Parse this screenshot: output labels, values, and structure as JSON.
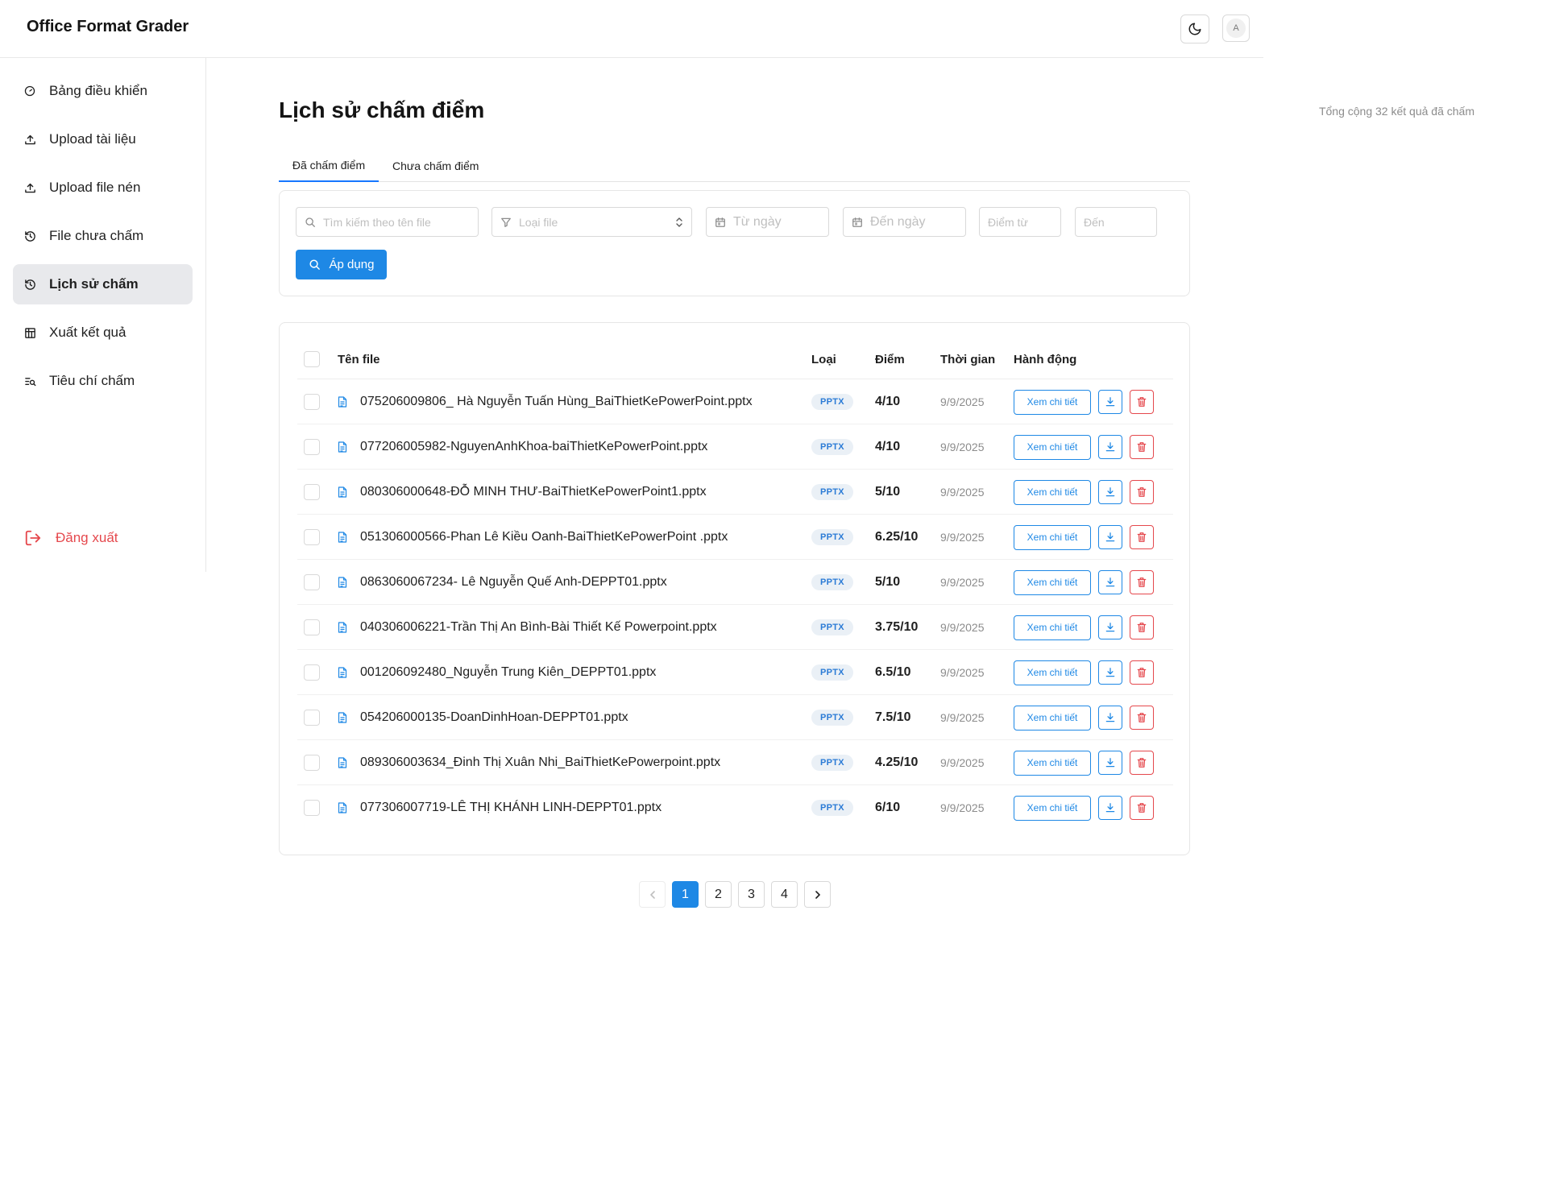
{
  "app": {
    "title": "Office Format Grader",
    "avatar_letter": "A"
  },
  "sidebar": {
    "items": [
      {
        "label": "Bảng điều khiển",
        "icon": "dashboard-icon"
      },
      {
        "label": "Upload tài liệu",
        "icon": "upload-icon"
      },
      {
        "label": "Upload file nén",
        "icon": "upload-icon"
      },
      {
        "label": "File chưa chấm",
        "icon": "history-icon"
      },
      {
        "label": "Lịch sử chấm",
        "icon": "history-icon",
        "active": true
      },
      {
        "label": "Xuất kết quả",
        "icon": "table-export-icon"
      },
      {
        "label": "Tiêu chí chấm",
        "icon": "list-search-icon"
      }
    ],
    "logout_label": "Đăng xuất"
  },
  "page": {
    "title": "Lịch sử chấm điểm",
    "total_text": "Tổng cộng 32 kết quả đã chấm",
    "tabs": [
      {
        "label": "Đã chấm điểm",
        "active": true
      },
      {
        "label": "Chưa chấm điểm",
        "active": false
      }
    ]
  },
  "filters": {
    "search_placeholder": "Tìm kiếm theo tên file",
    "filetype_placeholder": "Loại file",
    "from_date_placeholder": "Từ ngày",
    "to_date_placeholder": "Đến ngày",
    "score_from_placeholder": "Điểm từ",
    "score_to_placeholder": "Đến",
    "apply_label": "Áp dụng"
  },
  "table": {
    "headers": {
      "name": "Tên file",
      "type": "Loại",
      "score": "Điểm",
      "time": "Thời gian",
      "actions": "Hành động"
    },
    "detail_label": "Xem chi tiết",
    "rows": [
      {
        "name": "075206009806_ Hà Nguyễn Tuấn Hùng_BaiThietKePowerPoint.pptx",
        "type": "PPTX",
        "score": "4/10",
        "time": "9/9/2025"
      },
      {
        "name": "077206005982-NguyenAnhKhoa-baiThietKePowerPoint.pptx",
        "type": "PPTX",
        "score": "4/10",
        "time": "9/9/2025"
      },
      {
        "name": "080306000648-ĐỖ MINH THƯ-BaiThietKePowerPoint1.pptx",
        "type": "PPTX",
        "score": "5/10",
        "time": "9/9/2025"
      },
      {
        "name": "051306000566-Phan Lê Kiều Oanh-BaiThietKePowerPoint .pptx",
        "type": "PPTX",
        "score": "6.25/10",
        "time": "9/9/2025"
      },
      {
        "name": "0863060067234- Lê Nguyễn Quế Anh-DEPPT01.pptx",
        "type": "PPTX",
        "score": "5/10",
        "time": "9/9/2025"
      },
      {
        "name": "040306006221-Trần Thị An Bình-Bài Thiết Kế Powerpoint.pptx",
        "type": "PPTX",
        "score": "3.75/10",
        "time": "9/9/2025"
      },
      {
        "name": "001206092480_Nguyễn Trung Kiên_DEPPT01.pptx",
        "type": "PPTX",
        "score": "6.5/10",
        "time": "9/9/2025"
      },
      {
        "name": "054206000135-DoanDinhHoan-DEPPT01.pptx",
        "type": "PPTX",
        "score": "7.5/10",
        "time": "9/9/2025"
      },
      {
        "name": "089306003634_Đinh Thị Xuân Nhi_BaiThietKePowerpoint.pptx",
        "type": "PPTX",
        "score": "4.25/10",
        "time": "9/9/2025"
      },
      {
        "name": "077306007719-LÊ THỊ KHÁNH LINH-DEPPT01.pptx",
        "type": "PPTX",
        "score": "6/10",
        "time": "9/9/2025"
      }
    ]
  },
  "pagination": {
    "pages": [
      "1",
      "2",
      "3",
      "4"
    ],
    "current": "1"
  },
  "colors": {
    "primary": "#1e88e5",
    "danger": "#e5484d",
    "active_nav_bg": "#e8e9ec"
  }
}
